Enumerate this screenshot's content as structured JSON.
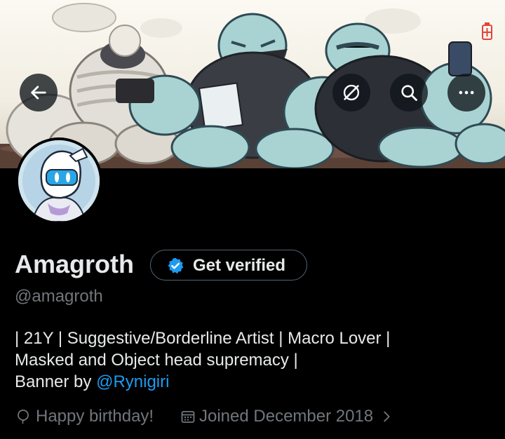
{
  "header": {
    "back_icon": "arrow-left-icon",
    "actions": [
      "grok-icon",
      "search-icon",
      "more-icon"
    ]
  },
  "profile": {
    "name": "Amagroth",
    "verify_label": "Get verified",
    "handle": "@amagroth",
    "bio_line1": "| 21Y | Suggestive/Borderline Artist | Macro Lover |",
    "bio_line2": "Masked and Object head supremacy |",
    "bio_line3_prefix": "Banner by ",
    "bio_link": "@Rynigiri",
    "birthday": "Happy birthday!",
    "joined": "Joined December 2018"
  },
  "colors": {
    "background": "#000000",
    "text": "#e7e9ea",
    "muted": "#71767b",
    "link": "#1d9bf0",
    "verified_badge": "#1d9bf0"
  }
}
